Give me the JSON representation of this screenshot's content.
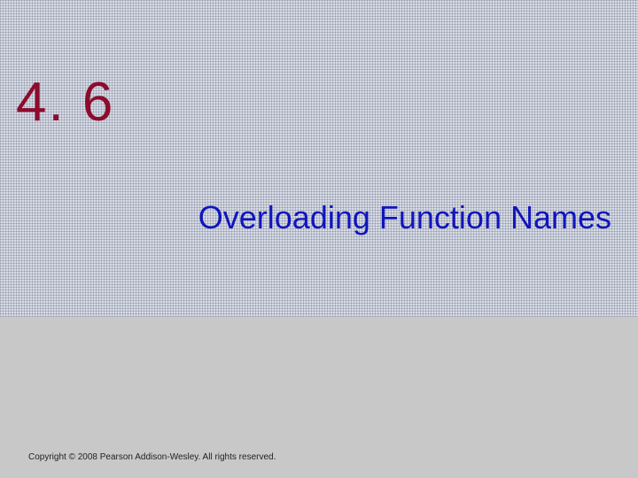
{
  "slide": {
    "section_number": "4. 6",
    "section_title": "Overloading Function Names",
    "copyright": "Copyright © 2008 Pearson Addison-Wesley. All rights reserved."
  }
}
